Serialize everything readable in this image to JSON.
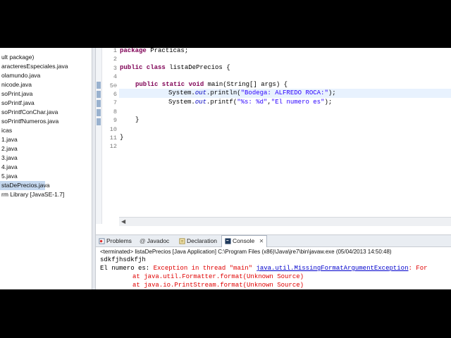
{
  "explorer": {
    "items": [
      "ult package)",
      "aracteresEspeciales.java",
      "olamundo.java",
      "nicode.java",
      "soPrint.java",
      "soPrintf.java",
      "soPrintfConChar.java",
      "soPrintfNumeros.java",
      "icas",
      "1.java",
      "2.java",
      "3.java",
      "4.java",
      "5.java",
      "staDePrecios.java",
      "rm Library [JavaSE-1.7]"
    ],
    "selected_index": 14
  },
  "editor": {
    "line_numbers": [
      "1",
      "2",
      "3",
      "4",
      "5⊖",
      "6",
      "7",
      "8",
      "9",
      "10",
      "11",
      "12"
    ],
    "code": {
      "l1_kw": "package",
      "l1_rest": " Practicas;",
      "l3_kw": "public class",
      "l3_rest": " listaDePrecios {",
      "l5_kw": "public static void",
      "l5_rest": " main(String[] args) {",
      "l6_prefix": "System.",
      "l6_field": "out",
      "l6_mid": ".println(",
      "l6_str": "\"Bodega: ALFREDO ROCA:\"",
      "l6_end": ");",
      "l7_prefix": "System.",
      "l7_field": "out",
      "l7_mid": ".printf(",
      "l7_str1": "\"%s: %d\"",
      "l7_comma": ",",
      "l7_str2": "\"El numero es\"",
      "l7_end": ");",
      "l9": "}",
      "l11": "}"
    }
  },
  "console": {
    "tabs": [
      "Problems",
      "Javadoc",
      "Declaration",
      "Console"
    ],
    "active_tab": "Console",
    "close_glyph": "✕",
    "description": "<terminated> listaDePrecios [Java Application] C:\\Program Files (x86)\\Java\\jre7\\bin\\javaw.exe (05/04/2013 14:50:48)",
    "output_line1": "sdkfjhsdkfjh",
    "output_line2_prefix": "El numero es: ",
    "output_line2_err": "Exception in thread \"main\" ",
    "output_line2_link": "java.util.MissingFormatArgumentException",
    "output_line2_tail": ": For",
    "output_line3": "at java.util.Formatter.format(Unknown Source)",
    "output_line4": "at java.io.PrintStream.format(Unknown Source)"
  },
  "colors": {
    "keyword": "#7f0055",
    "string": "#2a00ff",
    "field": "#0000c0",
    "error": "#e00000",
    "link": "#0000cc"
  }
}
